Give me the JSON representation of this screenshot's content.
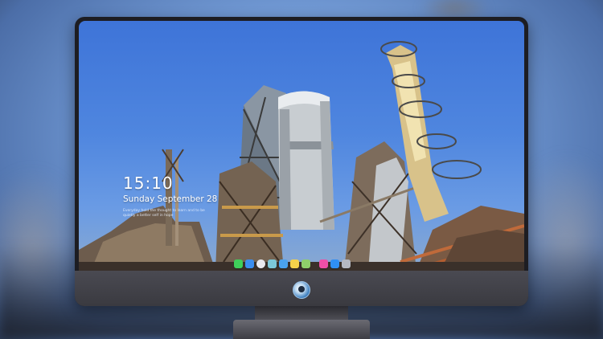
{
  "lockscreen": {
    "time": "15:10",
    "date": "Sunday September 28",
    "quote_line1": "Everyday hold the thought to learn and to be",
    "quote_line2": "quietly a better self in hope"
  },
  "dock": {
    "icons": [
      {
        "name": "messages-icon",
        "color": "#3fcf5a"
      },
      {
        "name": "files-icon",
        "color": "#3b8ef0"
      },
      {
        "name": "browser-icon",
        "color": "#e9e9ee"
      },
      {
        "name": "photos-icon",
        "color": "#7bc7d8"
      },
      {
        "name": "clapper-icon",
        "color": "#4aa3f0"
      },
      {
        "name": "notes-icon",
        "color": "#f5d24a"
      },
      {
        "name": "gallery-icon",
        "color": "#8fd06a"
      },
      {
        "name": "music-icon",
        "color": "#ef4fa6"
      },
      {
        "name": "app-store-icon",
        "color": "#2f8ff5"
      },
      {
        "name": "window-icon",
        "color": "#b4b8c2"
      }
    ]
  },
  "colors": {
    "sky": "#4f86df",
    "bezel": "#1d1d22",
    "chin": "#45454c"
  }
}
